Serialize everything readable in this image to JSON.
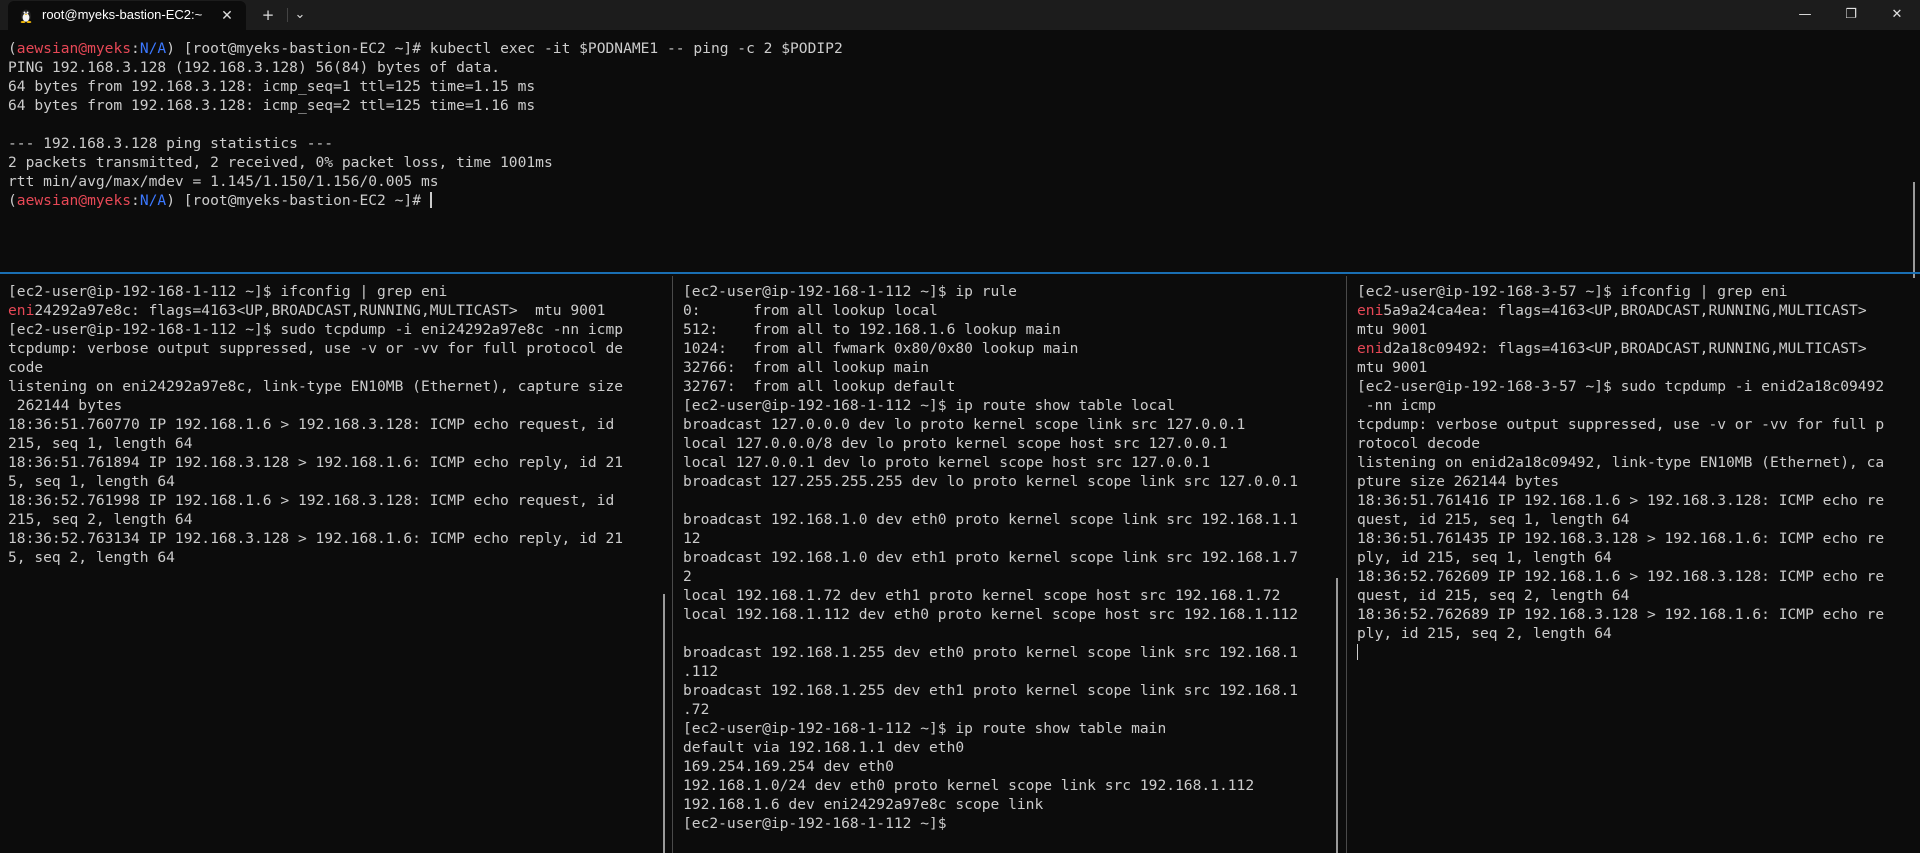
{
  "window": {
    "tab_title": "root@myeks-bastion-EC2:~",
    "tab_icon": "linux-tux-icon",
    "tab_close_glyph": "✕",
    "new_tab_glyph": "+",
    "dropdown_glyph": "⌄",
    "minimize_glyph": "—",
    "maximize_glyph": "❐",
    "close_glyph": "✕"
  },
  "colors": {
    "accent_split": "#1a6fb3",
    "prompt_user": "#e74856",
    "prompt_context": "#3b78ff",
    "terminal_fg": "#cccccc",
    "terminal_bg": "#0c0c0c"
  },
  "top_pane": {
    "prompt": {
      "open": "(",
      "user": "aewsian@myeks",
      "sep": ":",
      "context": "N/A",
      "close": ") [root@myeks-bastion-EC2 ~]# "
    },
    "command": "kubectl exec -it $PODNAME1 -- ping -c 2 $PODIP2",
    "output": [
      "PING 192.168.3.128 (192.168.3.128) 56(84) bytes of data.",
      "64 bytes from 192.168.3.128: icmp_seq=1 ttl=125 time=1.15 ms",
      "64 bytes from 192.168.3.128: icmp_seq=2 ttl=125 time=1.16 ms",
      "",
      "--- 192.168.3.128 ping statistics ---",
      "2 packets transmitted, 2 received, 0% packet loss, time 1001ms",
      "rtt min/avg/max/mdev = 1.145/1.150/1.156/0.005 ms"
    ]
  },
  "left_pane": {
    "line1": "[ec2-user@ip-192-168-1-112 ~]$ ifconfig | grep eni",
    "line2_match": "eni",
    "line2_rest": "24292a97e8c: flags=4163<UP,BROADCAST,RUNNING,MULTICAST>  mtu 9001",
    "rest": [
      "[ec2-user@ip-192-168-1-112 ~]$ sudo tcpdump -i eni24292a97e8c -nn icmp",
      "tcpdump: verbose output suppressed, use -v or -vv for full protocol de",
      "code",
      "listening on eni24292a97e8c, link-type EN10MB (Ethernet), capture size",
      " 262144 bytes",
      "18:36:51.760770 IP 192.168.1.6 > 192.168.3.128: ICMP echo request, id ",
      "215, seq 1, length 64",
      "18:36:51.761894 IP 192.168.3.128 > 192.168.1.6: ICMP echo reply, id 21",
      "5, seq 1, length 64",
      "18:36:52.761998 IP 192.168.1.6 > 192.168.3.128: ICMP echo request, id ",
      "215, seq 2, length 64",
      "18:36:52.763134 IP 192.168.3.128 > 192.168.1.6: ICMP echo reply, id 21",
      "5, seq 2, length 64"
    ]
  },
  "mid_pane": {
    "lines": [
      "[ec2-user@ip-192-168-1-112 ~]$ ip rule",
      "0:      from all lookup local",
      "512:    from all to 192.168.1.6 lookup main",
      "1024:   from all fwmark 0x80/0x80 lookup main",
      "32766:  from all lookup main",
      "32767:  from all lookup default",
      "[ec2-user@ip-192-168-1-112 ~]$ ip route show table local",
      "broadcast 127.0.0.0 dev lo proto kernel scope link src 127.0.0.1",
      "local 127.0.0.0/8 dev lo proto kernel scope host src 127.0.0.1",
      "local 127.0.0.1 dev lo proto kernel scope host src 127.0.0.1",
      "broadcast 127.255.255.255 dev lo proto kernel scope link src 127.0.0.1",
      "",
      "broadcast 192.168.1.0 dev eth0 proto kernel scope link src 192.168.1.1",
      "12",
      "broadcast 192.168.1.0 dev eth1 proto kernel scope link src 192.168.1.7",
      "2",
      "local 192.168.1.72 dev eth1 proto kernel scope host src 192.168.1.72",
      "local 192.168.1.112 dev eth0 proto kernel scope host src 192.168.1.112",
      "",
      "broadcast 192.168.1.255 dev eth0 proto kernel scope link src 192.168.1",
      ".112",
      "broadcast 192.168.1.255 dev eth1 proto kernel scope link src 192.168.1",
      ".72",
      "[ec2-user@ip-192-168-1-112 ~]$ ip route show table main",
      "default via 192.168.1.1 dev eth0",
      "169.254.169.254 dev eth0",
      "192.168.1.0/24 dev eth0 proto kernel scope link src 192.168.1.112",
      "192.168.1.6 dev eni24292a97e8c scope link",
      "[ec2-user@ip-192-168-1-112 ~]$"
    ]
  },
  "right_pane": {
    "line1": "[ec2-user@ip-192-168-3-57 ~]$ ifconfig | grep eni",
    "match": "eni",
    "line2_rest": "5a9a24ca4ea: flags=4163<UP,BROADCAST,RUNNING,MULTICAST>",
    "line3": "mtu 9001",
    "line4_rest": "d2a18c09492: flags=4163<UP,BROADCAST,RUNNING,MULTICAST>",
    "line5": "mtu 9001",
    "rest": [
      "[ec2-user@ip-192-168-3-57 ~]$ sudo tcpdump -i enid2a18c09492",
      " -nn icmp",
      "tcpdump: verbose output suppressed, use -v or -vv for full p",
      "rotocol decode",
      "listening on enid2a18c09492, link-type EN10MB (Ethernet), ca",
      "pture size 262144 bytes",
      "18:36:51.761416 IP 192.168.1.6 > 192.168.3.128: ICMP echo re",
      "quest, id 215, seq 1, length 64",
      "18:36:51.761435 IP 192.168.3.128 > 192.168.1.6: ICMP echo re",
      "ply, id 215, seq 1, length 64",
      "18:36:52.762609 IP 192.168.1.6 > 192.168.3.128: ICMP echo re",
      "quest, id 215, seq 2, length 64",
      "18:36:52.762689 IP 192.168.3.128 > 192.168.1.6: ICMP echo re",
      "ply, id 215, seq 2, length 64"
    ]
  }
}
